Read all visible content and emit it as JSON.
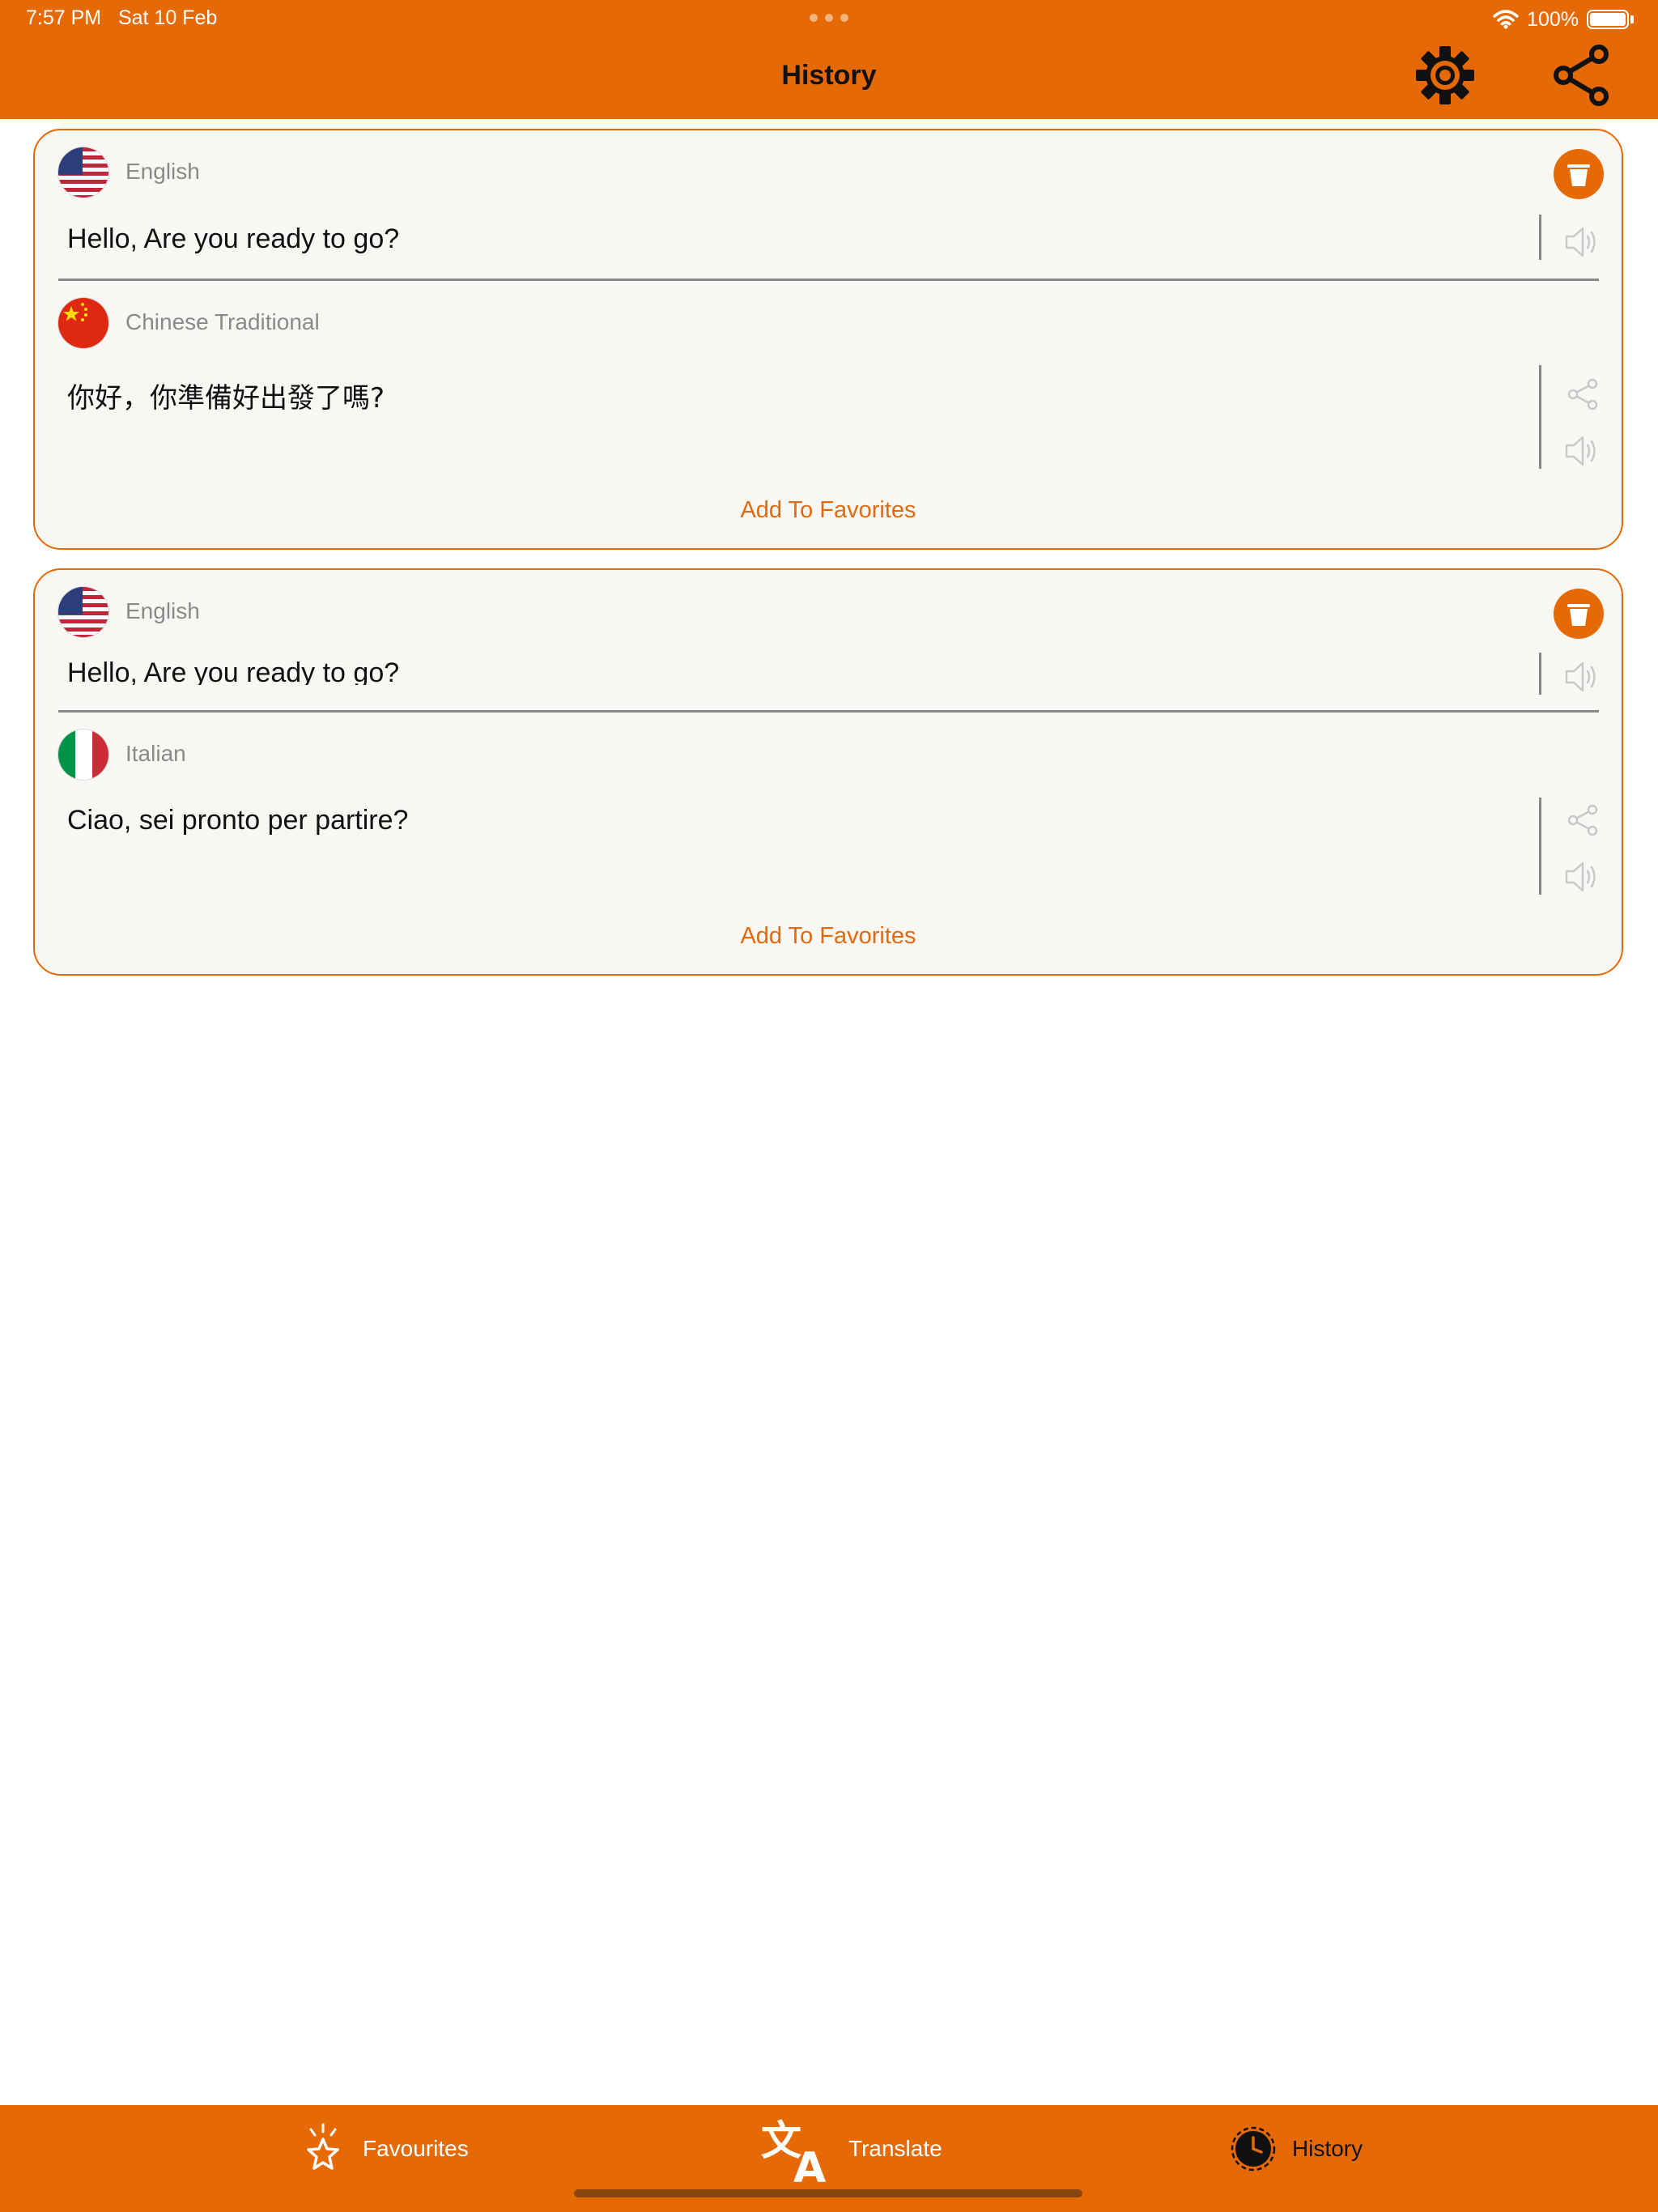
{
  "status_bar": {
    "time": "7:57 PM",
    "date": "Sat 10 Feb",
    "battery": "100%"
  },
  "header": {
    "title": "History",
    "settings_icon": "gear-icon",
    "share_icon": "share-icon"
  },
  "history": [
    {
      "source_language": "English",
      "source_flag": "us-flag",
      "source_text": "Hello, Are you ready to go?",
      "target_language": "Chinese Traditional",
      "target_flag": "china-flag",
      "target_text": "你好，你準備好出發了嗎?",
      "favorite_label": "Add To Favorites"
    },
    {
      "source_language": "English",
      "source_flag": "us-flag",
      "source_text": "Hello, Are you ready to go?",
      "target_language": "Italian",
      "target_flag": "italy-flag",
      "target_text": "Ciao, sei pronto per partire?",
      "favorite_label": "Add To Favorites"
    }
  ],
  "tabbar": {
    "favourites": "Favourites",
    "translate": "Translate",
    "history": "History",
    "active": "History"
  },
  "colors": {
    "accent": "#E56A05",
    "card_bg": "#F9F7F4",
    "label_gray": "#8A8A8A"
  }
}
